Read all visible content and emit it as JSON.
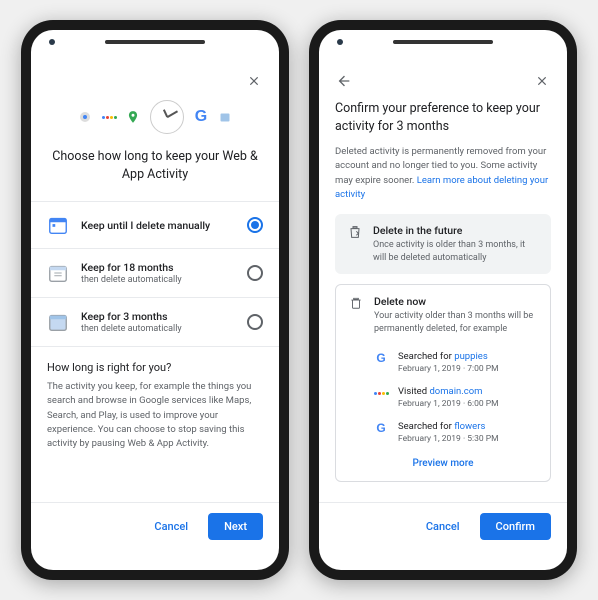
{
  "left": {
    "title": "Choose how long to keep your Web & App Activity",
    "options": [
      {
        "label": "Keep until I delete manually",
        "sub": "",
        "selected": true
      },
      {
        "label": "Keep for 18 months",
        "sub": "then delete automatically",
        "selected": false
      },
      {
        "label": "Keep for 3 months",
        "sub": "then delete automatically",
        "selected": false
      }
    ],
    "info_title": "How long is right for you?",
    "info_body": "The activity you keep, for example the things you search and browse in Google services like Maps, Search, and Play, is used to improve your experience. You can choose to stop saving this activity by pausing Web & App Activity.",
    "cancel": "Cancel",
    "next": "Next"
  },
  "right": {
    "title": "Confirm your preference to keep your activity for 3 months",
    "subtext_prefix": "Deleted activity is permanently removed from your account and no longer tied to you. Some activity may expire sooner. ",
    "subtext_link": "Learn more about deleting your activity",
    "future": {
      "title": "Delete in the future",
      "sub": "Once activity is older than 3 months, it will be deleted automatically"
    },
    "now": {
      "title": "Delete now",
      "sub": "Your activity older than 3 months will be permanently deleted, for example"
    },
    "activities": [
      {
        "icon": "google-g",
        "prefix": "Searched for ",
        "link": "puppies",
        "time": "February 1, 2019 · 7:00 PM"
      },
      {
        "icon": "assistant",
        "prefix": "Visited ",
        "link": "domain.com",
        "time": "February 1, 2019 · 6:00 PM"
      },
      {
        "icon": "google-g",
        "prefix": "Searched for ",
        "link": "flowers",
        "time": "February 1, 2019 · 5:30 PM"
      }
    ],
    "preview_more": "Preview more",
    "cancel": "Cancel",
    "confirm": "Confirm"
  }
}
